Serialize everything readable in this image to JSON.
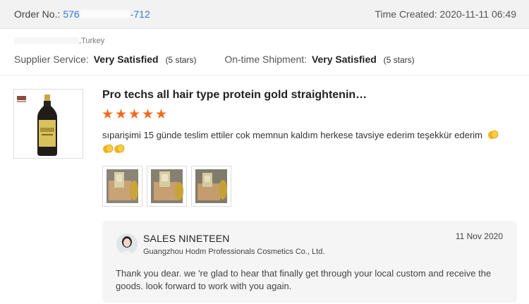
{
  "order": {
    "label": "Order No.:",
    "number_prefix": "576",
    "number_suffix": "-712",
    "time_created": "Time Created: 2020-11-11 06:49"
  },
  "buyer": {
    "country": ",Turkey"
  },
  "ratings": {
    "supplier_service_label": "Supplier Service:",
    "supplier_service_value": "Very Satisfied",
    "supplier_service_stars": "(5 stars)",
    "shipment_label": "On-time Shipment:",
    "shipment_value": "Very Satisfied",
    "shipment_stars": "(5 stars)"
  },
  "product": {
    "title": "Pro techs all hair type protein gold straightenin…",
    "rating": 5,
    "star_color": "#f26b1d"
  },
  "review": {
    "text": "sıparişimi 15 günde teslim ettiler cok memnun kaldım herkese tavsiye ederim teşekkür ederim",
    "emoji": "clapping-hands-icon",
    "photo_count": 3
  },
  "reply": {
    "name": "SALES NINETEEN",
    "company": "Guangzhou Hodm Professionals Cosmetics Co., Ltd.",
    "date": "11 Nov 2020",
    "text": "Thank you dear. we 're glad to hear that finally get through your local custom and receive the goods.  look forward to work with you again."
  },
  "colors": {
    "link": "#2f7fd1",
    "header_bg": "#f2f2f2",
    "reply_bg": "#f5f5f5"
  }
}
